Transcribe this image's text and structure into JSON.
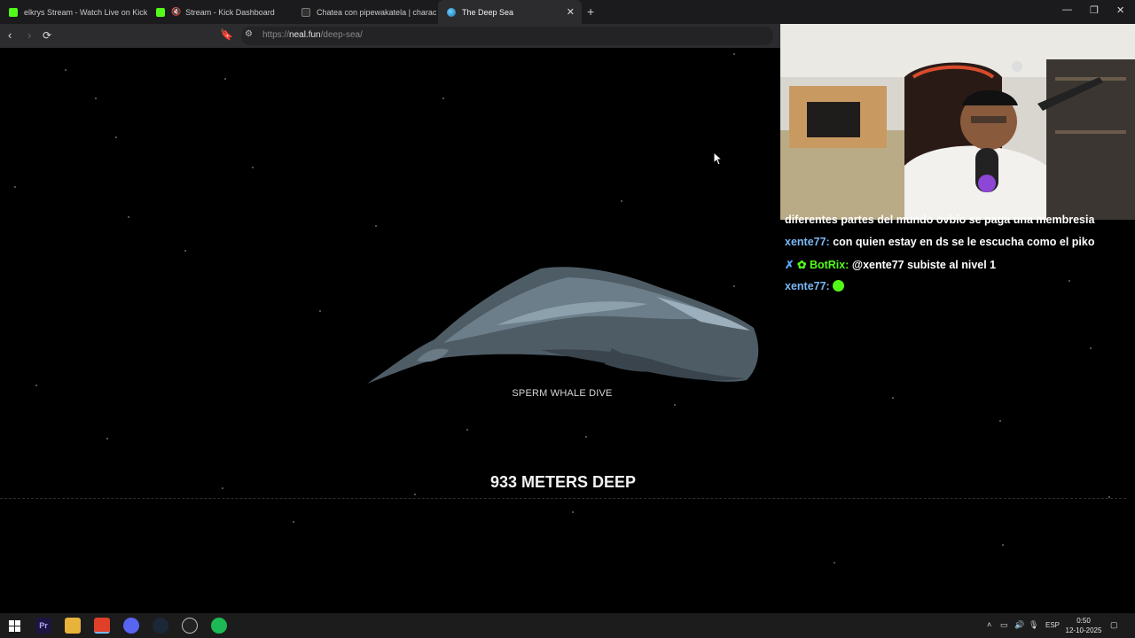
{
  "browser": {
    "tabs": [
      {
        "label": "elkrys Stream - Watch Live on Kick",
        "favicon": "kick-icon",
        "active": false
      },
      {
        "label": "Stream - Kick Dashboard",
        "favicon": "kick-icon",
        "active": false,
        "muted": true
      },
      {
        "label": "Chatea con pipewakatela | character",
        "favicon": "character-ai-icon",
        "active": false
      },
      {
        "label": "The Deep Sea",
        "favicon": "deep-sea-icon",
        "active": true
      }
    ],
    "url_scheme": "https://",
    "url_host": "neal.fun",
    "url_path": "/deep-sea/"
  },
  "page": {
    "creature_label": "SPERM WHALE DIVE",
    "depth_label": "933 METERS DEEP",
    "background_color": "#000000"
  },
  "stream_overlay": {
    "chat": [
      {
        "user": "",
        "text": "diferentes partes del mundo ovbio se paga una membresia"
      },
      {
        "user": "xente77:",
        "text": "con quien estay en ds se le escucha como el piko"
      },
      {
        "user": "BotRix:",
        "text": "@xente77 subiste al nivel 1"
      },
      {
        "user": "xente77:",
        "text": ""
      }
    ]
  },
  "taskbar": {
    "apps": [
      "windows-start-icon",
      "premiere-pro-icon",
      "file-explorer-icon",
      "brave-browser-icon",
      "discord-icon",
      "steam-icon",
      "obs-icon",
      "spotify-icon"
    ],
    "language": "ESP",
    "time": "0:50",
    "date": "12-10-2025"
  }
}
